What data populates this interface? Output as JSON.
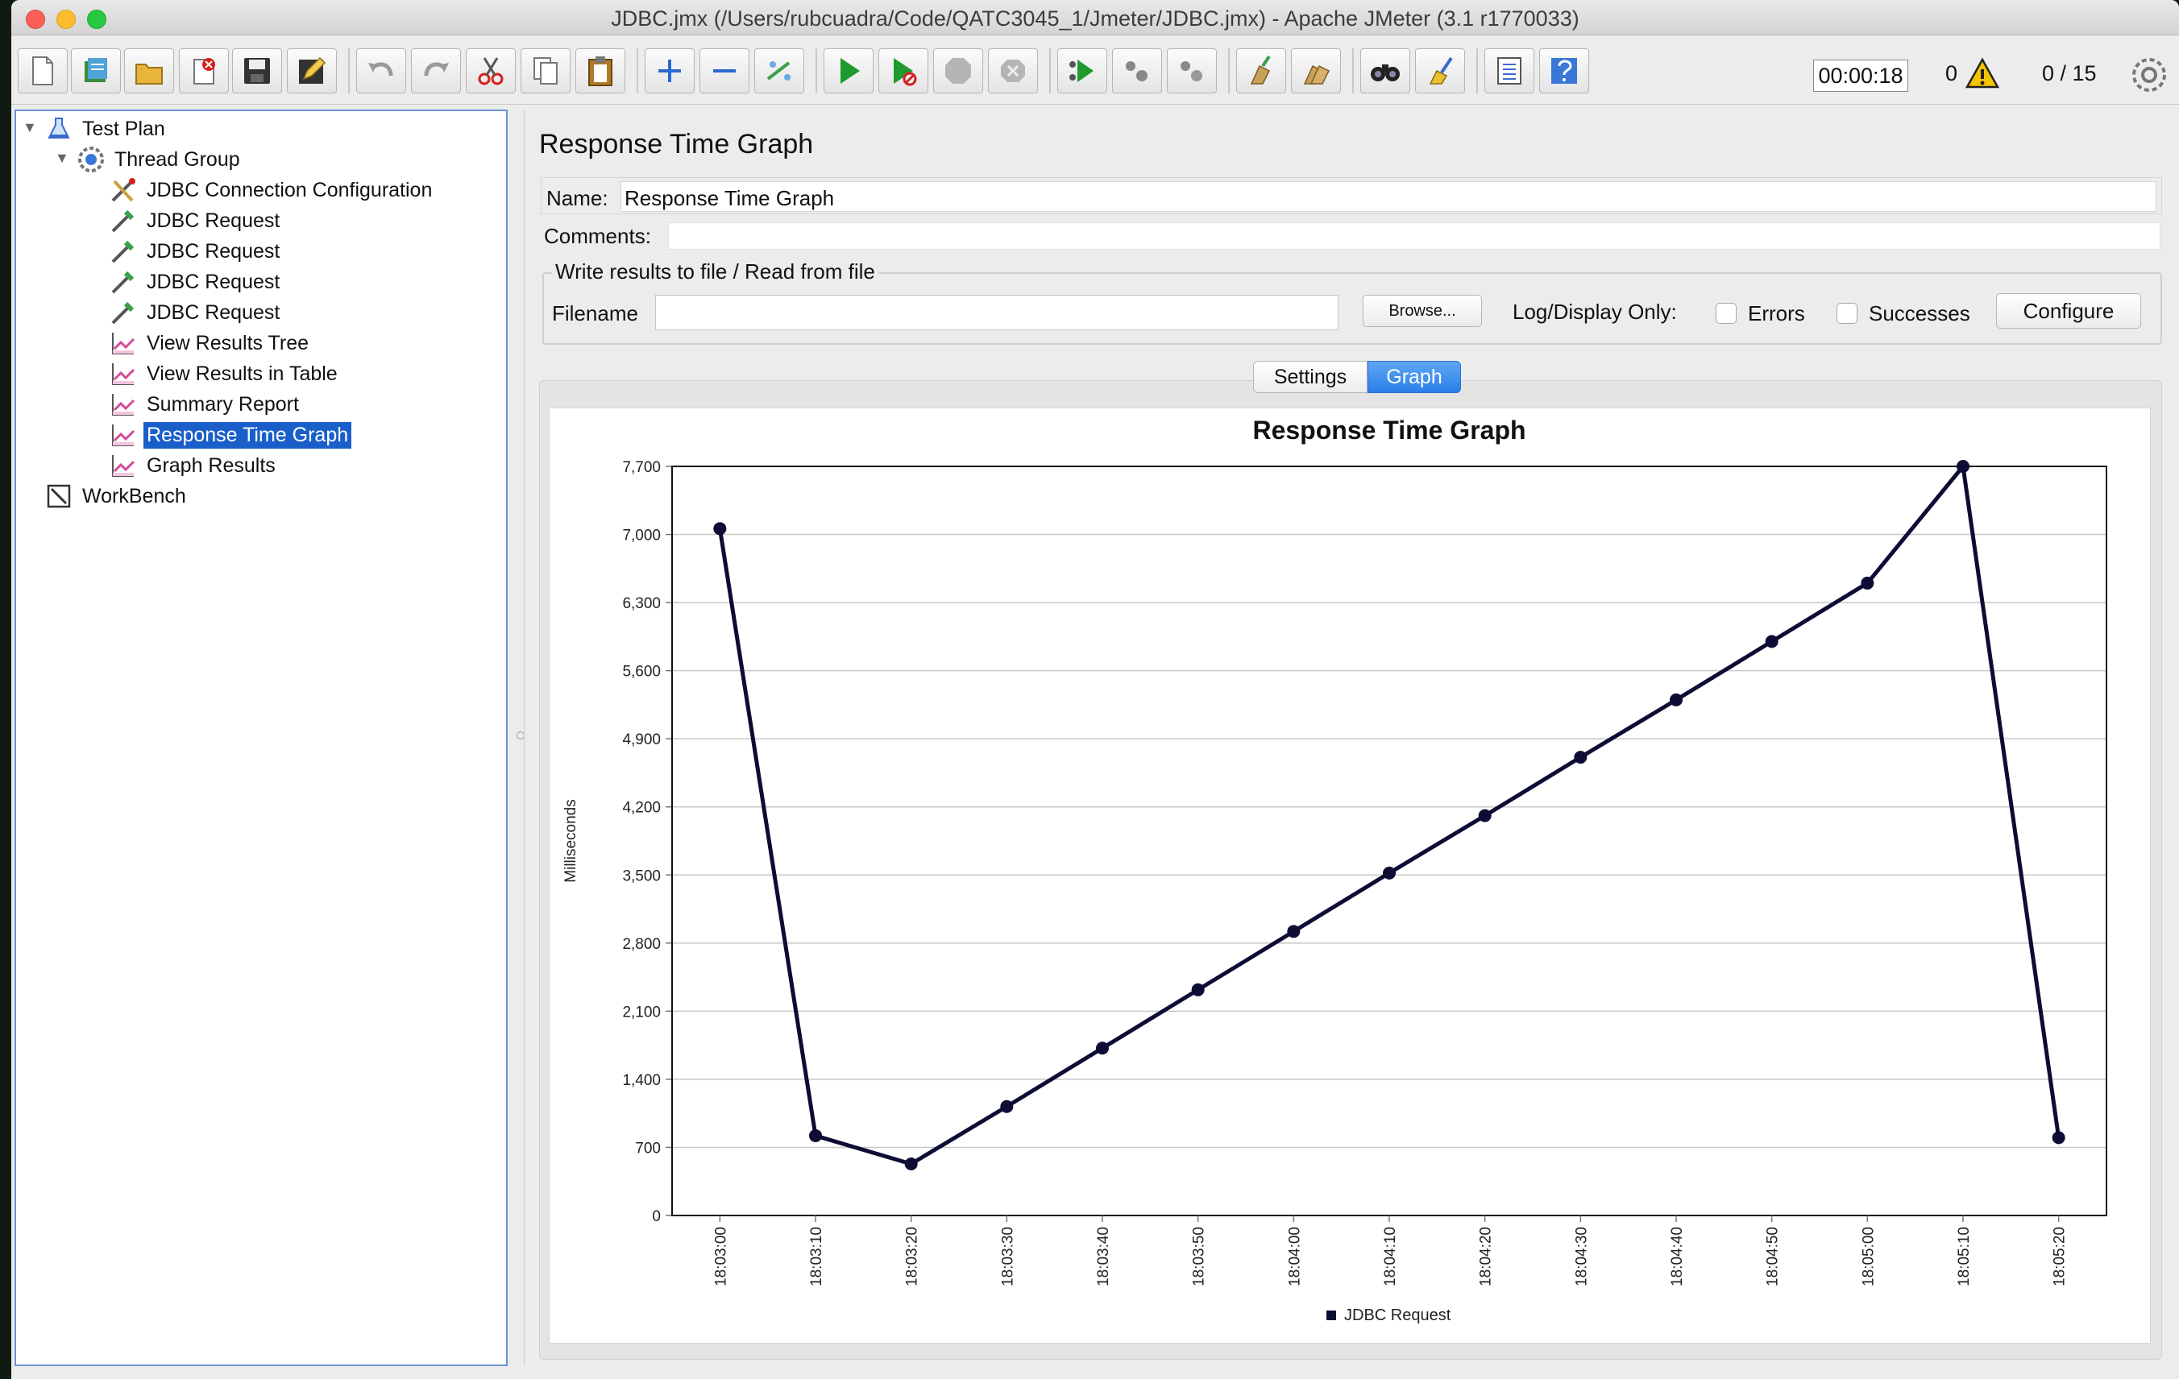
{
  "window": {
    "title": "JDBC.jmx (/Users/rubcuadra/Code/QATC3045_1/Jmeter/JDBC.jmx) - Apache JMeter (3.1 r1770033)"
  },
  "toolbar": {
    "timer": "00:00:18",
    "error_count": "0",
    "threads": "0 / 15"
  },
  "tree": {
    "items": [
      {
        "label": "Test Plan",
        "icon": "test-plan-icon"
      },
      {
        "label": "Thread Group",
        "icon": "thread-group-icon"
      },
      {
        "label": "JDBC Connection Configuration",
        "icon": "config-tools-icon"
      },
      {
        "label": "JDBC Request",
        "icon": "sampler-pipette-icon"
      },
      {
        "label": "JDBC Request",
        "icon": "sampler-pipette-icon"
      },
      {
        "label": "JDBC Request",
        "icon": "sampler-pipette-icon"
      },
      {
        "label": "JDBC Request",
        "icon": "sampler-pipette-icon"
      },
      {
        "label": "View Results Tree",
        "icon": "listener-graph-icon"
      },
      {
        "label": "View Results in Table",
        "icon": "listener-graph-icon"
      },
      {
        "label": "Summary Report",
        "icon": "listener-graph-icon"
      },
      {
        "label": "Response Time Graph",
        "icon": "listener-graph-icon"
      },
      {
        "label": "Graph Results",
        "icon": "listener-graph-icon"
      },
      {
        "label": "WorkBench",
        "icon": "workbench-icon"
      }
    ]
  },
  "panel": {
    "title": "Response Time Graph",
    "name_label": "Name:",
    "name_value": "Response Time Graph",
    "comments_label": "Comments:",
    "file_group_label": "Write results to file / Read from file",
    "filename_label": "Filename",
    "browse_label": "Browse...",
    "log_display_label": "Log/Display Only:",
    "errors_label": "Errors",
    "successes_label": "Successes",
    "configure_label": "Configure",
    "tabs": [
      {
        "label": "Settings"
      },
      {
        "label": "Graph"
      }
    ]
  },
  "colors": {
    "selection": "#1a5fc9",
    "tab_active": "#2c7fe8",
    "series": "#0d0c35"
  },
  "chart_data": {
    "type": "line",
    "title": "Response Time Graph",
    "xlabel": "",
    "ylabel": "Milliseconds",
    "ylim": [
      0,
      7700
    ],
    "yticks": [
      0,
      700,
      1400,
      2100,
      2800,
      3500,
      4200,
      4900,
      5600,
      6300,
      7000,
      7700
    ],
    "ytick_labels": [
      "0",
      "700",
      "1,400",
      "2,100",
      "2,800",
      "3,500",
      "4,200",
      "4,900",
      "5,600",
      "6,300",
      "7,000",
      "7,700"
    ],
    "categories": [
      "18:03:00",
      "18:03:10",
      "18:03:20",
      "18:03:30",
      "18:03:40",
      "18:03:50",
      "18:04:00",
      "18:04:10",
      "18:04:20",
      "18:04:30",
      "18:04:40",
      "18:04:50",
      "18:05:00",
      "18:05:10",
      "18:05:20"
    ],
    "series": [
      {
        "name": "JDBC Request",
        "values": [
          7060,
          820,
          530,
          1120,
          1720,
          2320,
          2920,
          3520,
          4110,
          4710,
          5300,
          5900,
          6500,
          7700,
          800
        ]
      }
    ],
    "grid": true,
    "legend": "bottom"
  }
}
